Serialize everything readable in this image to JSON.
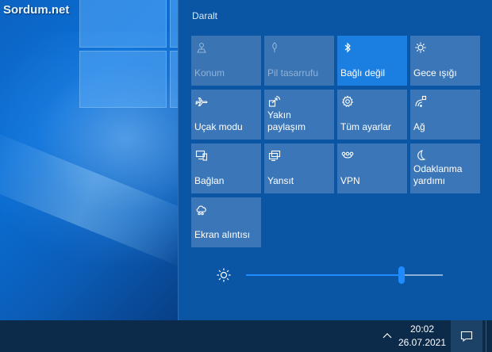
{
  "watermark": "Sordum.net",
  "action_center": {
    "collapse_label": "Daralt",
    "tiles": [
      {
        "label": "Konum",
        "icon": "location-icon",
        "state": "disabled"
      },
      {
        "label": "Pil tasarrufu",
        "icon": "battery-saver-icon",
        "state": "disabled"
      },
      {
        "label": "Bağlı değil",
        "icon": "bluetooth-icon",
        "state": "active"
      },
      {
        "label": "Gece ışığı",
        "icon": "night-light-icon",
        "state": "normal"
      },
      {
        "label": "Uçak modu",
        "icon": "airplane-icon",
        "state": "normal"
      },
      {
        "label": "Yakın paylaşım",
        "icon": "nearby-share-icon",
        "state": "normal"
      },
      {
        "label": "Tüm ayarlar",
        "icon": "gear-icon",
        "state": "normal"
      },
      {
        "label": "Ağ",
        "icon": "network-icon",
        "state": "normal"
      },
      {
        "label": "Bağlan",
        "icon": "connect-icon",
        "state": "normal"
      },
      {
        "label": "Yansıt",
        "icon": "project-icon",
        "state": "normal"
      },
      {
        "label": "VPN",
        "icon": "vpn-icon",
        "state": "normal"
      },
      {
        "label": "Odaklanma yardımı",
        "icon": "moon-icon",
        "state": "normal"
      },
      {
        "label": "Ekran alıntısı",
        "icon": "snip-icon",
        "state": "normal"
      }
    ],
    "brightness": {
      "value": 0.79,
      "icon": "brightness-icon"
    }
  },
  "taskbar": {
    "time": "20:02",
    "date": "26.07.2021",
    "chevron_icon": "chevron-up-icon",
    "notification_icon": "notification-icon"
  },
  "colors": {
    "panel": "#0b56a4",
    "tile": "#3b77b8",
    "tile_active": "#1a7fe0",
    "accent": "#1f8bff",
    "taskbar": "#0c2b4a"
  }
}
